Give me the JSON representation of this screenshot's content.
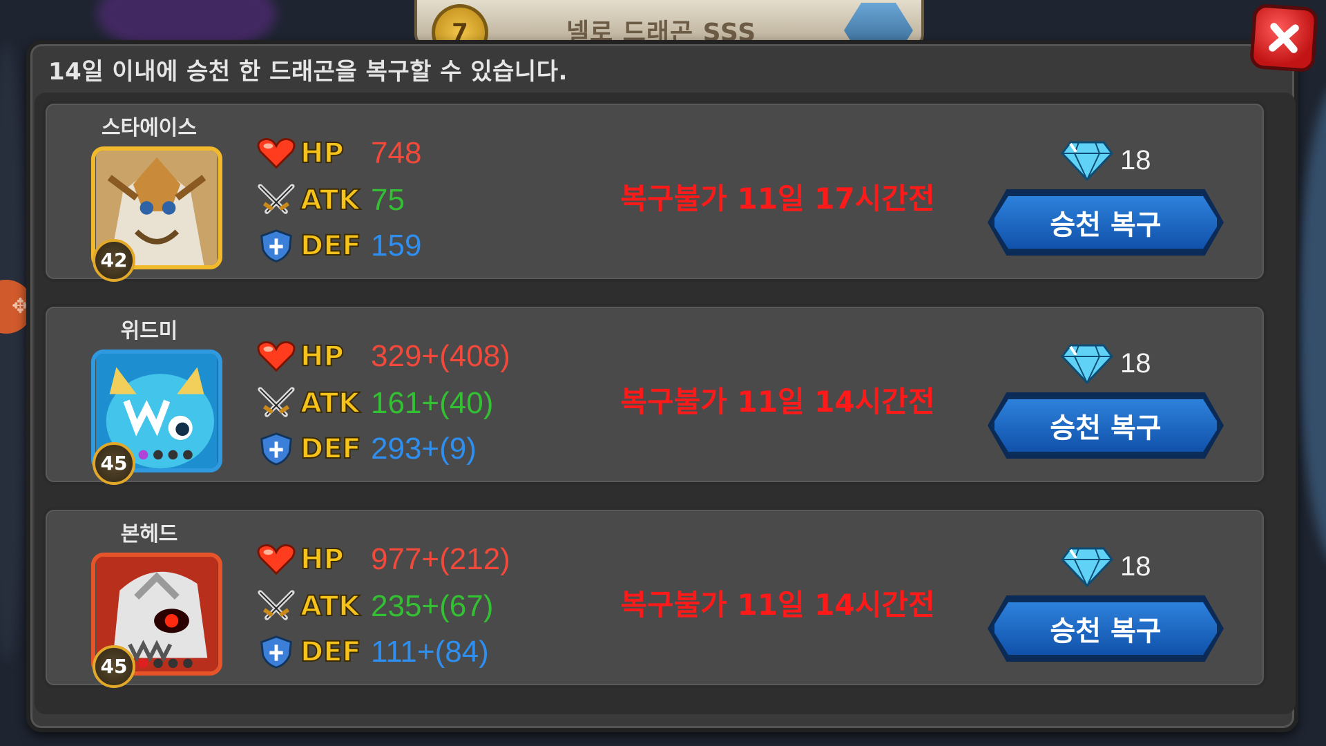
{
  "background": {
    "level": "7",
    "title": "넬로 드래곤 SSS"
  },
  "dialog": {
    "notice": "14일 이내에 승천 한 드래곤을 복구할 수 있습니다.",
    "close_icon": "close-icon",
    "labels": {
      "hp": "HP",
      "atk": "ATK",
      "def": "DEF"
    },
    "dragons": [
      {
        "name": "스타에이스",
        "level": "42",
        "hp": "748",
        "atk": "75",
        "def": "159",
        "timer": "복구불가 11일 17시간전",
        "price": "18",
        "button": "승천 복구",
        "frame_color": "#f1b92c"
      },
      {
        "name": "위드미",
        "level": "45",
        "hp": "329+(408)",
        "atk": "161+(40)",
        "def": "293+(9)",
        "timer": "복구불가 11일 14시간전",
        "price": "18",
        "button": "승천 복구",
        "frame_color": "#2f9ae0"
      },
      {
        "name": "본헤드",
        "level": "45",
        "hp": "977+(212)",
        "atk": "235+(67)",
        "def": "111+(84)",
        "timer": "복구불가 11일 14시간전",
        "price": "18",
        "button": "승천 복구",
        "frame_color": "#e8542a"
      }
    ]
  },
  "colors": {
    "hp": "#f2493b",
    "atk": "#33c033",
    "def": "#2e8ff0",
    "timer": "#ff1a1a",
    "button": "#1f6fc8"
  }
}
